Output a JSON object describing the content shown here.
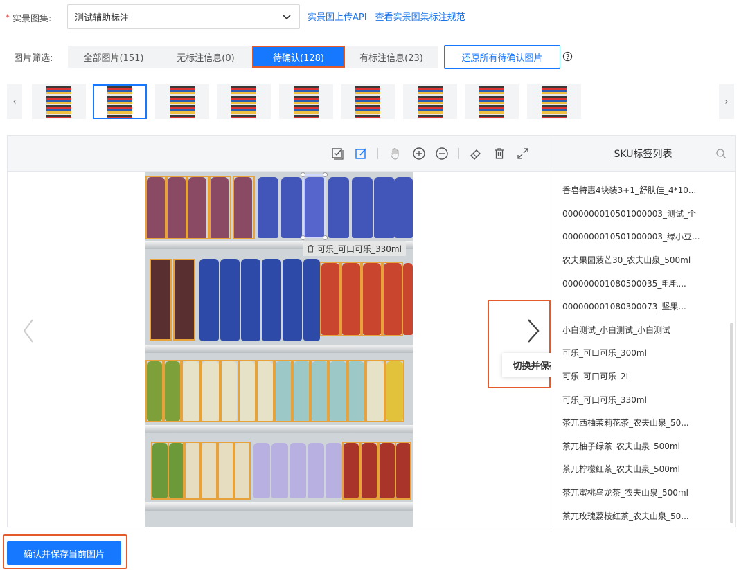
{
  "gallery": {
    "required_mark": "*",
    "label": "实景图集:",
    "selected": "测试辅助标注",
    "links": [
      "实景图上传API",
      "查看实景图集标注规范"
    ]
  },
  "filter": {
    "label": "图片筛选:",
    "tabs": [
      {
        "label": "全部图片(151)",
        "active": false
      },
      {
        "label": "无标注信息(0)",
        "active": false
      },
      {
        "label": "待确认(128)",
        "active": true
      },
      {
        "label": "有标注信息(23)",
        "active": false
      }
    ],
    "restore_label": "还原所有待确认图片",
    "help_icon": "question-circle-icon"
  },
  "thumbnails": {
    "count": 9,
    "selected_index": 1
  },
  "toolbar": {
    "icons": [
      "check-all-icon",
      "edit-icon",
      "hand-icon",
      "zoom-in-icon",
      "zoom-out-icon",
      "eraser-icon",
      "trash-icon",
      "fullscreen-icon"
    ]
  },
  "canvas": {
    "selected_box_label": "可乐_可口可乐_330ml",
    "switch_tooltip": "切换并保存"
  },
  "sku_panel": {
    "title": "SKU标签列表",
    "items": [
      "香皂特惠4块装3+1_舒肤佳_4*10...",
      "0000000010501000003_测试_个",
      "0000000010501000003_绿小豆...",
      "农夫果园菠芒30_农夫山泉_500ml",
      "000000001080500035_毛毛...",
      "000000001080300073_坚果...",
      "小白测试_小白测试_小白测试",
      "可乐_可口可乐_300ml",
      "可乐_可口可乐_2L",
      "可乐_可口可乐_330ml",
      "茶兀西柚茉莉花茶_农夫山泉_50...",
      "茶兀柚子绿茶_农夫山泉_500ml",
      "茶兀柠檬红茶_农夫山泉_500ml",
      "茶兀蜜桃乌龙茶_农夫山泉_500ml",
      "茶兀玫瑰荔枝红茶_农夫山泉_50..."
    ]
  },
  "footer": {
    "confirm_label": "确认并保存当前图片"
  },
  "colors": {
    "primary": "#1677ff",
    "highlight": "#e35a2b",
    "box": "#e8a23a"
  }
}
